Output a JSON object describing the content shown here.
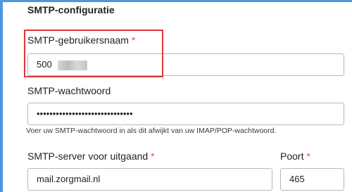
{
  "section": {
    "title": "SMTP-configuratie"
  },
  "username": {
    "label": "SMTP-gebruikersnaam",
    "required_mark": "*",
    "value": "500"
  },
  "password": {
    "label": "SMTP-wachtwoord",
    "value": "••••••••••••••••••••••••••••••",
    "hint": "Voer uw SMTP-wachtwoord in als dit afwijkt van uw IMAP/POP-wachtwoord."
  },
  "server": {
    "label": "SMTP-server voor uitgaand",
    "required_mark": "*",
    "value": "mail.zorgmail.nl"
  },
  "port": {
    "label": "Poort",
    "required_mark": "*",
    "value": "465"
  },
  "colors": {
    "accent": "#4f95e0",
    "required": "#d9534f",
    "highlight": "#e0373d"
  }
}
